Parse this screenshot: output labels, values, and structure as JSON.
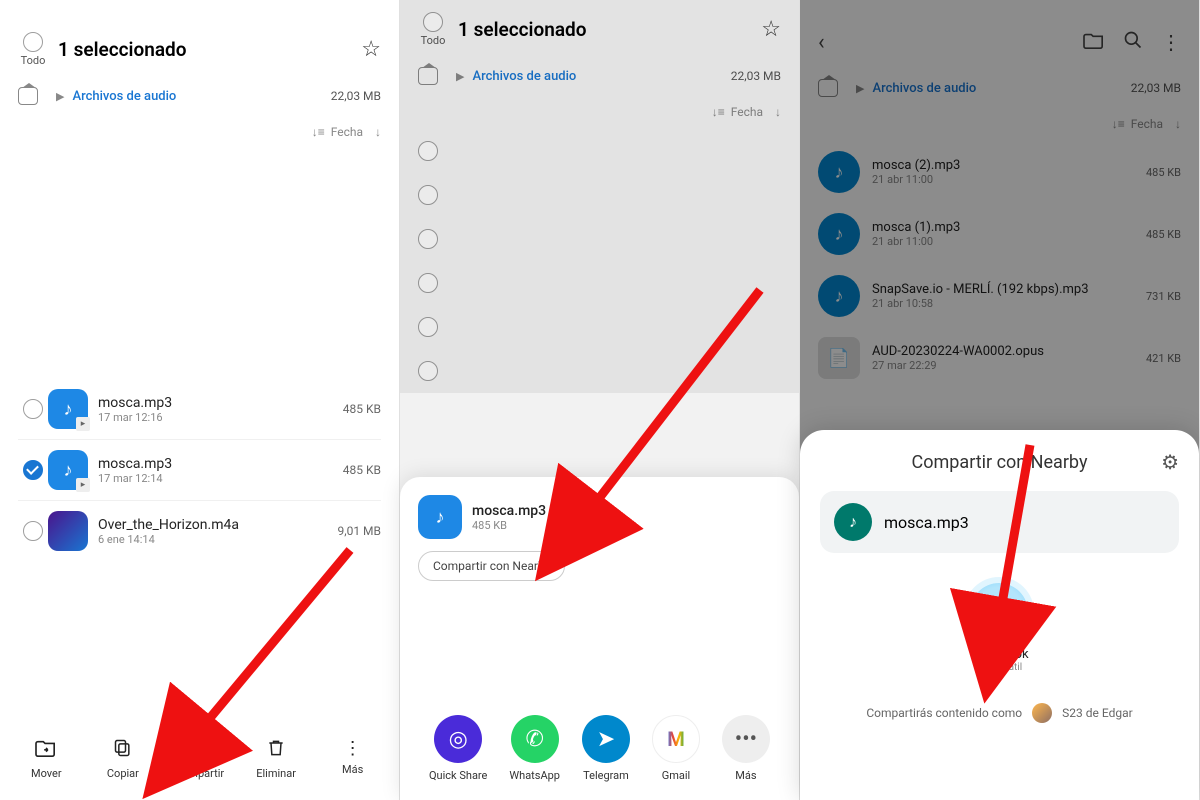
{
  "panel1": {
    "todo_label": "Todo",
    "title": "1 seleccionado",
    "breadcrumb": {
      "link": "Archivos de audio",
      "size": "22,03 MB"
    },
    "sort_label": "Fecha",
    "files": [
      {
        "name": "mosca.mp3",
        "date": "17 mar 12:16",
        "size": "485 KB",
        "checked": false,
        "kind": "audio"
      },
      {
        "name": "mosca.mp3",
        "date": "17 mar 12:14",
        "size": "485 KB",
        "checked": true,
        "kind": "audio"
      },
      {
        "name": "Over_the_Horizon.m4a",
        "date": "6 ene 14:14",
        "size": "9,01 MB",
        "checked": false,
        "kind": "image"
      }
    ],
    "actions": [
      {
        "label": "Mover",
        "icon": "⎘"
      },
      {
        "label": "Copiar",
        "icon": "⧉"
      },
      {
        "label": "Compartir",
        "icon": "<"
      },
      {
        "label": "Eliminar",
        "icon": "🗑"
      },
      {
        "label": "Más",
        "icon": "⋮"
      }
    ]
  },
  "panel2": {
    "todo_label": "Todo",
    "title": "1 seleccionado",
    "breadcrumb": {
      "link": "Archivos de audio",
      "size": "22,03 MB"
    },
    "sort_label": "Fecha",
    "share_file": {
      "name": "mosca.mp3",
      "size": "485 KB"
    },
    "nearby_chip": "Compartir con Nearby",
    "apps": [
      {
        "label": "Quick Share"
      },
      {
        "label": "WhatsApp"
      },
      {
        "label": "Telegram"
      },
      {
        "label": "Gmail"
      },
      {
        "label": "Más"
      }
    ]
  },
  "panel3": {
    "breadcrumb": {
      "link": "Archivos de audio",
      "size": "22,03 MB"
    },
    "sort_label": "Fecha",
    "files": [
      {
        "name": "mosca (2).mp3",
        "date": "21 abr 11:00",
        "size": "485 KB",
        "kind": "audio"
      },
      {
        "name": "mosca (1).mp3",
        "date": "21 abr 11:00",
        "size": "485 KB",
        "kind": "audio"
      },
      {
        "name": "SnapSave.io - MERLÍ. (192 kbps).mp3",
        "date": "21 abr 10:58",
        "size": "731 KB",
        "kind": "audio"
      },
      {
        "name": "AUD-20230224-WA0002.opus",
        "date": "27 mar 22:29",
        "size": "421 KB",
        "kind": "doc"
      }
    ],
    "sheet": {
      "title": "Compartir con Nearby",
      "file": "mosca.mp3",
      "device": {
        "name": "Matebook",
        "sub": "Tu portátil"
      },
      "footer_label": "Compartirás contenido como",
      "footer_user": "S23 de Edgar"
    }
  }
}
